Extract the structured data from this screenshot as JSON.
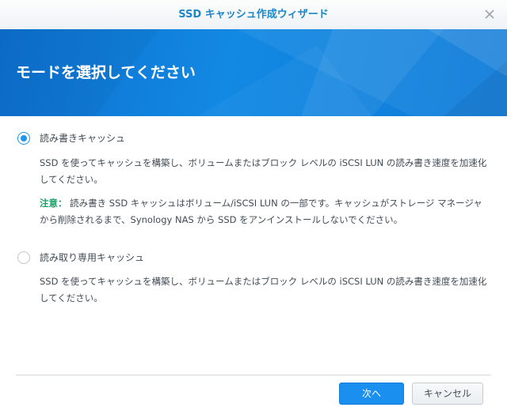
{
  "window": {
    "title": "SSD キャッシュ作成ウィザード",
    "close_icon": "close-icon"
  },
  "banner": {
    "heading": "モードを選択してください"
  },
  "options": [
    {
      "label": "読み書きキャッシュ",
      "selected": true,
      "description": "SSD を使ってキャッシュを構築し、ボリュームまたはブロック レベルの iSCSI LUN の読み書き速度を加速化してください。",
      "note_label": "注意：",
      "note_text": "読み書き SSD キャッシュはボリューム/iSCSI LUN の一部です。キャッシュがストレージ マネージャから削除されるまで、Synology NAS から SSD をアンインストールしないでください。"
    },
    {
      "label": "読み取り専用キャッシュ",
      "selected": false,
      "description": "SSD を使ってキャッシュを構築し、ボリュームまたはブロック レベルの iSCSI LUN の読み書き速度を加速化してください。"
    }
  ],
  "footer": {
    "next_label": "次へ",
    "cancel_label": "キャンセル"
  },
  "colors": {
    "accent": "#1f95e5",
    "banner": "#1289e3",
    "note": "#1aa269",
    "title": "#1d86c6"
  }
}
